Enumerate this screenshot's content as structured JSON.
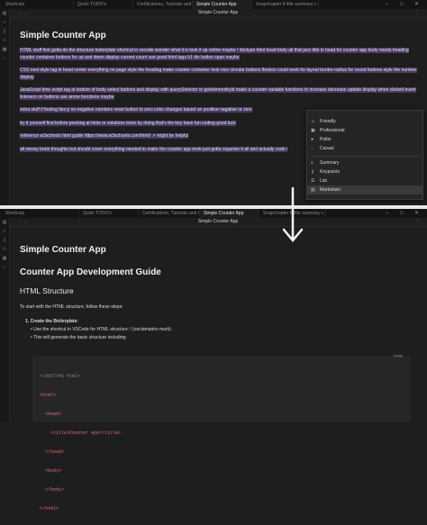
{
  "top": {
    "tabs": [
      "Shortcuts",
      "Quick TODO's",
      "Certifications, Tutorials and Co...",
      "Simple Counter App",
      "Snapchapter 8 title summary c..."
    ],
    "title": "Simple Counter App",
    "heading": "Simple Counter App",
    "paragraphs": [
      "HTML stuff first gotta do the structure boilerplate shortcut in vscode wonder what it is look it up online maybe ! doctype html head body all that jazz title in head for counter app body needs heading counter container buttons for up and down display current count use good html tags h1 div button span maybe",
      "CSS next style tag in head center everything on page style the heading make counter container look nice circular buttons flexbox could work for layout border-radius for round buttons style the number display",
      "JavaScript time script tag at bottom of body select buttons and display with querySelector or getelementbyid make a counter variable functions to increase decrease update display when clicked event listeners on buttons use arrow functions maybe",
      "extra stuff if feeling fancy no negative numbers reset button to zero color changes based on positive negative or zero",
      "try it yourself first before peeking at hints or solutions learn by doing that's the key have fun coding good luck",
      "reference w3schools html guide https://www.w3schools.com/html/ ↗ might be helpful",
      "all messy brain thoughts but should cover everything needed to make the counter app work just gotta organize it all and actually code i"
    ],
    "menu": {
      "tone_items": [
        "Friendly",
        "Professional",
        "Polite",
        "Casual"
      ],
      "format_items": [
        "Summary",
        "Keypoints",
        "List",
        "Markdown"
      ],
      "highlighted": "Markdown"
    }
  },
  "bottom": {
    "tabs": [
      "Shortcuts",
      "Quick TODO's",
      "Certifications, Tutorials and Co...",
      "Simple Counter App",
      "Snapchapter 8 title summary c..."
    ],
    "title": "Simple Counter App",
    "heading": "Simple Counter App",
    "guide_heading": "Counter App Development Guide",
    "section_heading": "HTML Structure",
    "intro": "To start with the HTML structure, follow these steps:",
    "step_title": "Create the Boilerplate:",
    "bullet1": "Use the shortcut in VSCode for HTML structure: ! (exclamation mark).",
    "bullet2": "This will generate the basic structure including:",
    "code_lang": "HTML",
    "code_lines": [
      "<!DOCTYPE html>",
      "<html>",
      "  <head>",
      "    <title>Counter App</title>",
      "  </head>",
      "  <body>",
      "  </body>",
      "</html>"
    ]
  }
}
